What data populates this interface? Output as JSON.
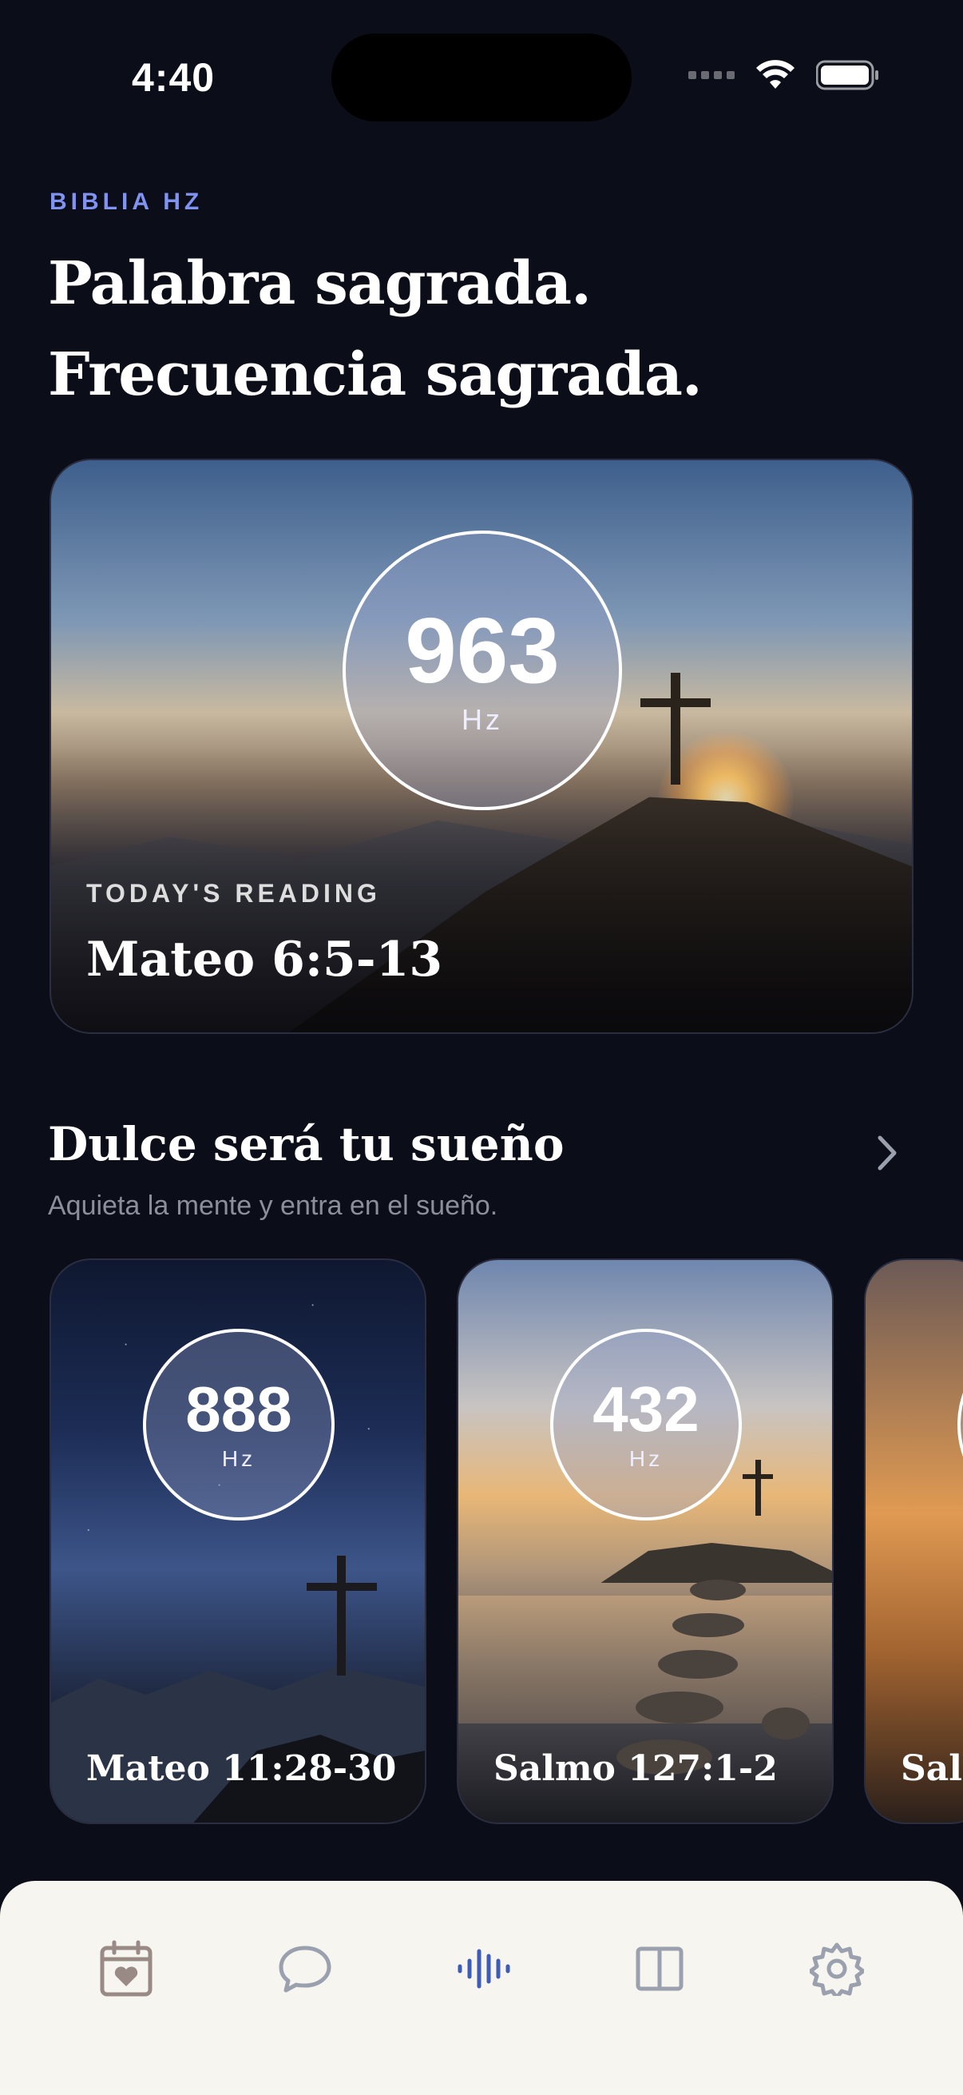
{
  "status_bar": {
    "time": "4:40"
  },
  "header": {
    "eyebrow": "BIBLIA HZ",
    "headline_line1": "Palabra sagrada.",
    "headline_line2": "Frecuencia sagrada."
  },
  "hero": {
    "frequency": "963",
    "unit": "Hz",
    "label": "TODAY'S READING",
    "reference": "Mateo 6:5-13"
  },
  "section": {
    "title": "Dulce será tu sueño",
    "subtitle": "Aquieta la mente y entra en el sueño.",
    "cards": [
      {
        "frequency": "888",
        "unit": "Hz",
        "reference": "Mateo 11:28-30"
      },
      {
        "frequency": "432",
        "unit": "Hz",
        "reference": "Salmo 127:1-2"
      },
      {
        "frequency": "",
        "unit": "",
        "reference": "Salr"
      }
    ]
  },
  "tabbar": {
    "items": [
      {
        "icon": "calendar-heart-icon"
      },
      {
        "icon": "chat-bubble-icon"
      },
      {
        "icon": "waveform-icon",
        "active": true
      },
      {
        "icon": "book-icon"
      },
      {
        "icon": "gear-icon"
      }
    ],
    "active_color": "#3f5bb8",
    "inactive_color": "#9aa0ad"
  }
}
